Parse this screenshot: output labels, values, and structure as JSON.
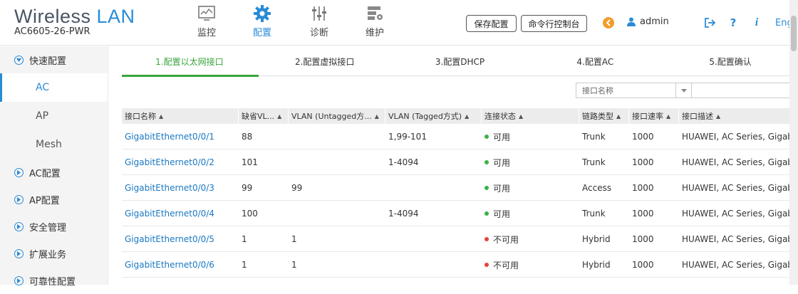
{
  "brand": {
    "title_main": "Wireless",
    "title_accent": "LAN",
    "model": "AC6605-26-PWR"
  },
  "nav": [
    {
      "label": "监控",
      "icon": "monitor-icon"
    },
    {
      "label": "配置",
      "icon": "gear-icon"
    },
    {
      "label": "诊断",
      "icon": "diagnose-icon"
    },
    {
      "label": "维护",
      "icon": "maintain-icon"
    }
  ],
  "header": {
    "save_label": "保存配置",
    "console_label": "命令行控制台",
    "user": "admin",
    "lang": "Eng"
  },
  "sidebar": {
    "groups": [
      {
        "label": "快速配置"
      },
      {
        "label": "AC配置"
      },
      {
        "label": "AP配置"
      },
      {
        "label": "安全管理"
      },
      {
        "label": "扩展业务"
      },
      {
        "label": "可靠性配置"
      }
    ],
    "subitems": [
      {
        "label": "AC"
      },
      {
        "label": "AP"
      },
      {
        "label": "Mesh"
      }
    ]
  },
  "steps": [
    {
      "label": "1.配置以太网接口"
    },
    {
      "label": "2.配置虚拟接口"
    },
    {
      "label": "3.配置DHCP"
    },
    {
      "label": "4.配置AC"
    },
    {
      "label": "5.配置确认"
    }
  ],
  "filter": {
    "placeholder": "接口名称"
  },
  "table": {
    "columns": [
      "接口名称",
      "缺省VL...",
      "VLAN (Untagged方...",
      "VLAN (Tagged方式)",
      "连接状态",
      "链路类型",
      "接口速率",
      "接口描述"
    ],
    "rows": [
      {
        "name": "GigabitEthernet0/0/1",
        "pvid": "88",
        "untagged": "",
        "tagged": "1,99-101",
        "status": "可用",
        "ok": true,
        "type": "Trunk",
        "speed": "1000",
        "desc": "HUAWEI, AC Series, GigabitEthernet"
      },
      {
        "name": "GigabitEthernet0/0/2",
        "pvid": "101",
        "untagged": "",
        "tagged": "1-4094",
        "status": "可用",
        "ok": true,
        "type": "Trunk",
        "speed": "1000",
        "desc": "HUAWEI, AC Series, GigabitEthernet"
      },
      {
        "name": "GigabitEthernet0/0/3",
        "pvid": "99",
        "untagged": "99",
        "tagged": "",
        "status": "可用",
        "ok": true,
        "type": "Access",
        "speed": "1000",
        "desc": "HUAWEI, AC Series, GigabitEthernet"
      },
      {
        "name": "GigabitEthernet0/0/4",
        "pvid": "100",
        "untagged": "",
        "tagged": "1-4094",
        "status": "可用",
        "ok": true,
        "type": "Trunk",
        "speed": "1000",
        "desc": "HUAWEI, AC Series, GigabitEthernet"
      },
      {
        "name": "GigabitEthernet0/0/5",
        "pvid": "1",
        "untagged": "1",
        "tagged": "",
        "status": "不可用",
        "ok": false,
        "type": "Hybrid",
        "speed": "1000",
        "desc": "HUAWEI, AC Series, GigabitEthernet"
      },
      {
        "name": "GigabitEthernet0/0/6",
        "pvid": "1",
        "untagged": "1",
        "tagged": "",
        "status": "不可用",
        "ok": false,
        "type": "Hybrid",
        "speed": "1000",
        "desc": "HUAWEI, AC Series, GigabitEthernet"
      }
    ]
  },
  "colors": {
    "accent": "#2a8bd6",
    "step_active": "#39a53b",
    "ok": "#39b34a",
    "bad": "#e84040"
  }
}
